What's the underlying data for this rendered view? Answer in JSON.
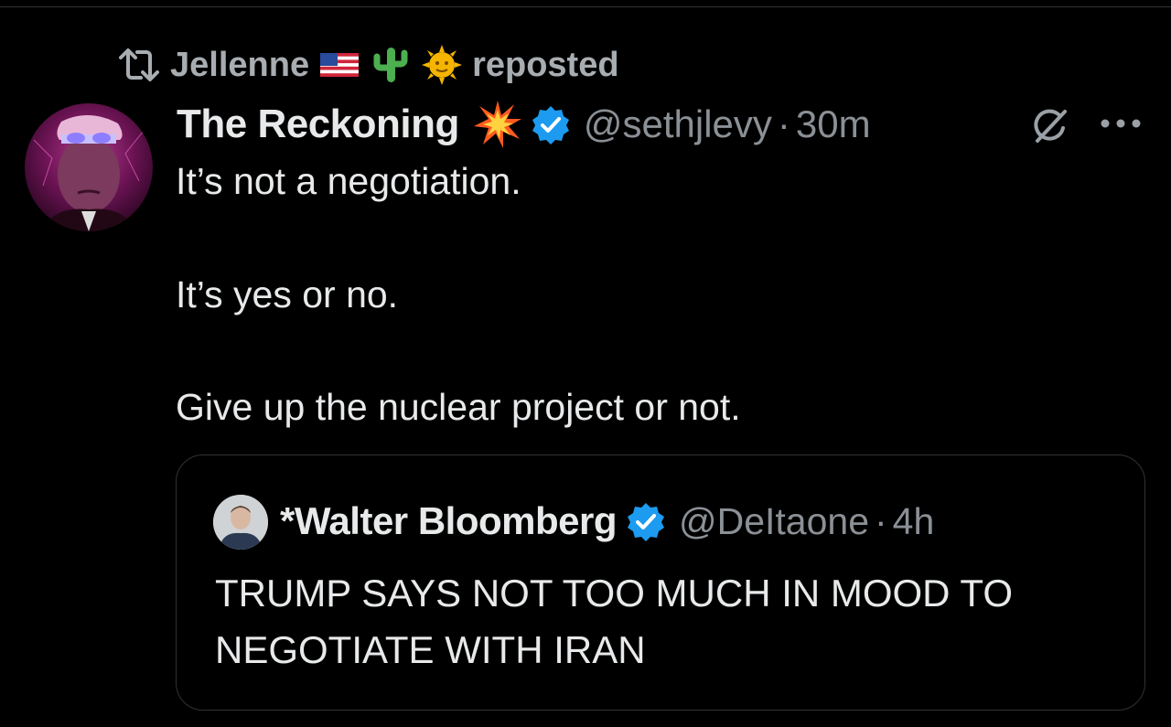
{
  "repost": {
    "user": "Jellenne",
    "suffix": "reposted",
    "emojis": [
      "us-flag-icon",
      "cactus-icon",
      "sun-face-icon"
    ]
  },
  "tweet": {
    "display_name": "The Reckoning",
    "name_emoji": "collision-icon",
    "handle": "@sethjlevy",
    "separator": "·",
    "time": "30m",
    "lines": [
      "It’s not a negotiation.",
      "It’s yes or no.",
      "Give up the nuclear project or not."
    ]
  },
  "quote": {
    "display_name": "*Walter Bloomberg",
    "handle": "@DeItaone",
    "separator": "·",
    "time": "4h",
    "text": "TRUMP SAYS NOT TOO MUCH IN MOOD TO NEGOTIATE WITH IRAN"
  },
  "colors": {
    "background": "#000000",
    "text_primary": "#e7e9ea",
    "text_secondary": "#8b9096",
    "verified_blue": "#1d9bf0",
    "border": "#2f3336"
  }
}
